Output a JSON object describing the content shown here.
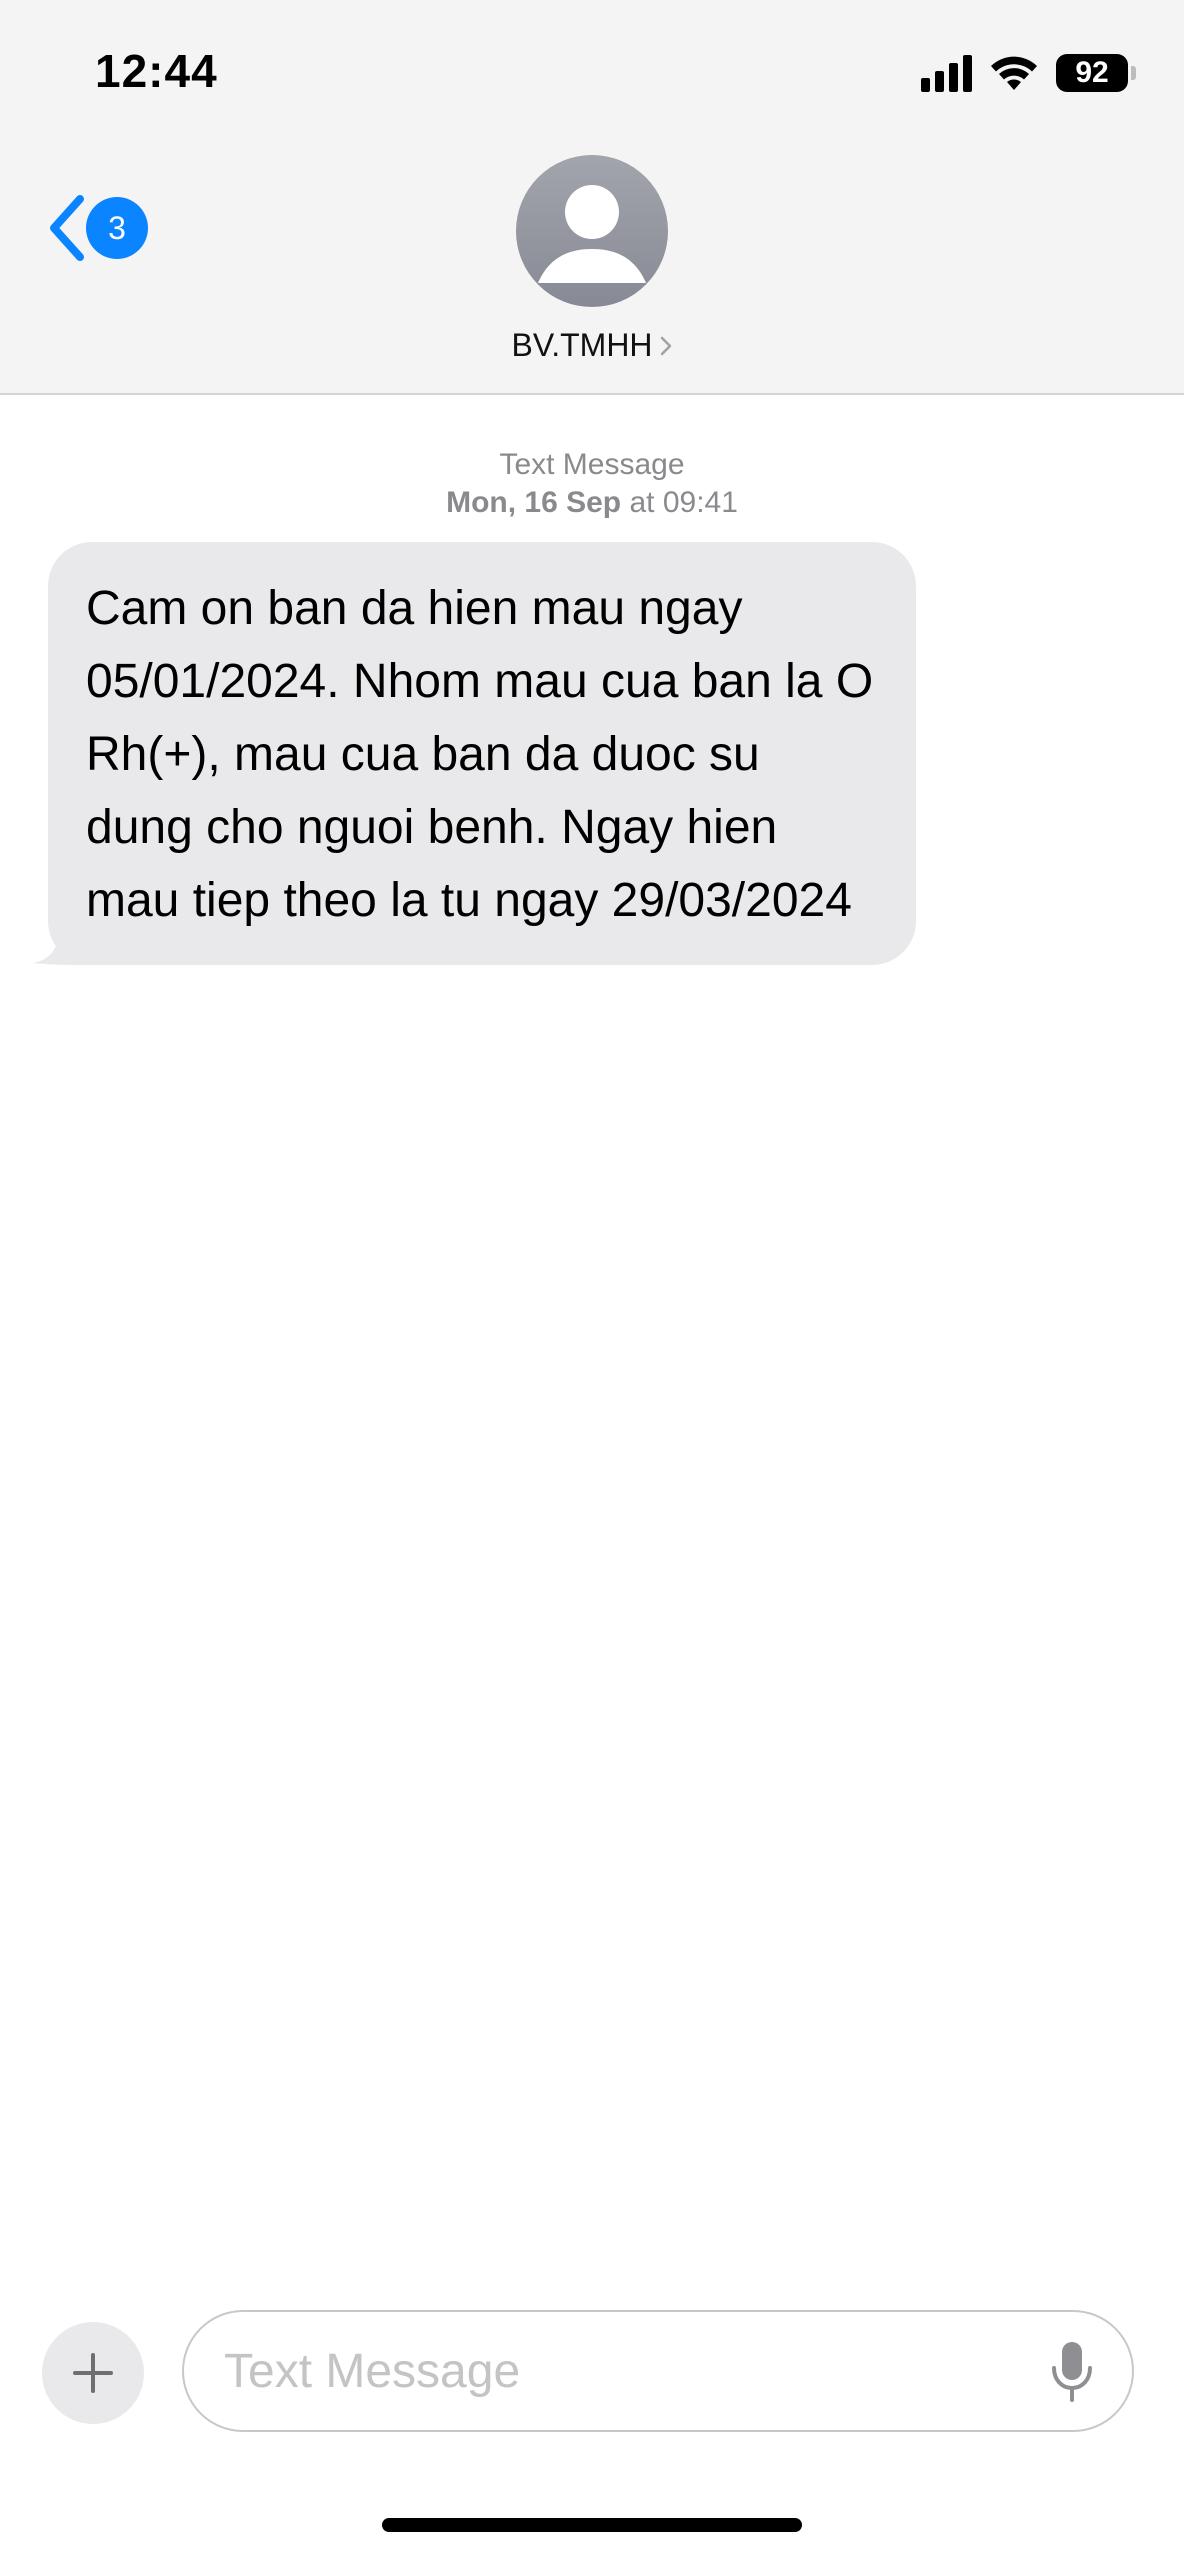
{
  "status_bar": {
    "time": "12:44",
    "battery": "92",
    "icons": [
      "signal-icon",
      "wifi-icon",
      "battery-icon"
    ]
  },
  "nav": {
    "back_badge": "3",
    "contact_name": "BV.TMHH"
  },
  "conversation": {
    "service": "Text Message",
    "date_day": "Mon, 16 Sep",
    "date_time": "at 09:41",
    "messages": [
      {
        "direction": "incoming",
        "text": "Cam on ban da hien mau ngay 05/01/2024. Nhom mau cua ban la O Rh(+), mau cua ban da duoc su dung cho nguoi benh. Ngay hien mau tiep theo la tu ngay 29/03/2024"
      }
    ]
  },
  "composer": {
    "placeholder": "Text Message"
  },
  "colors": {
    "accent": "#0a84ff",
    "incoming_bubble": "#e9e9eb",
    "header_bg": "#f4f4f5"
  }
}
